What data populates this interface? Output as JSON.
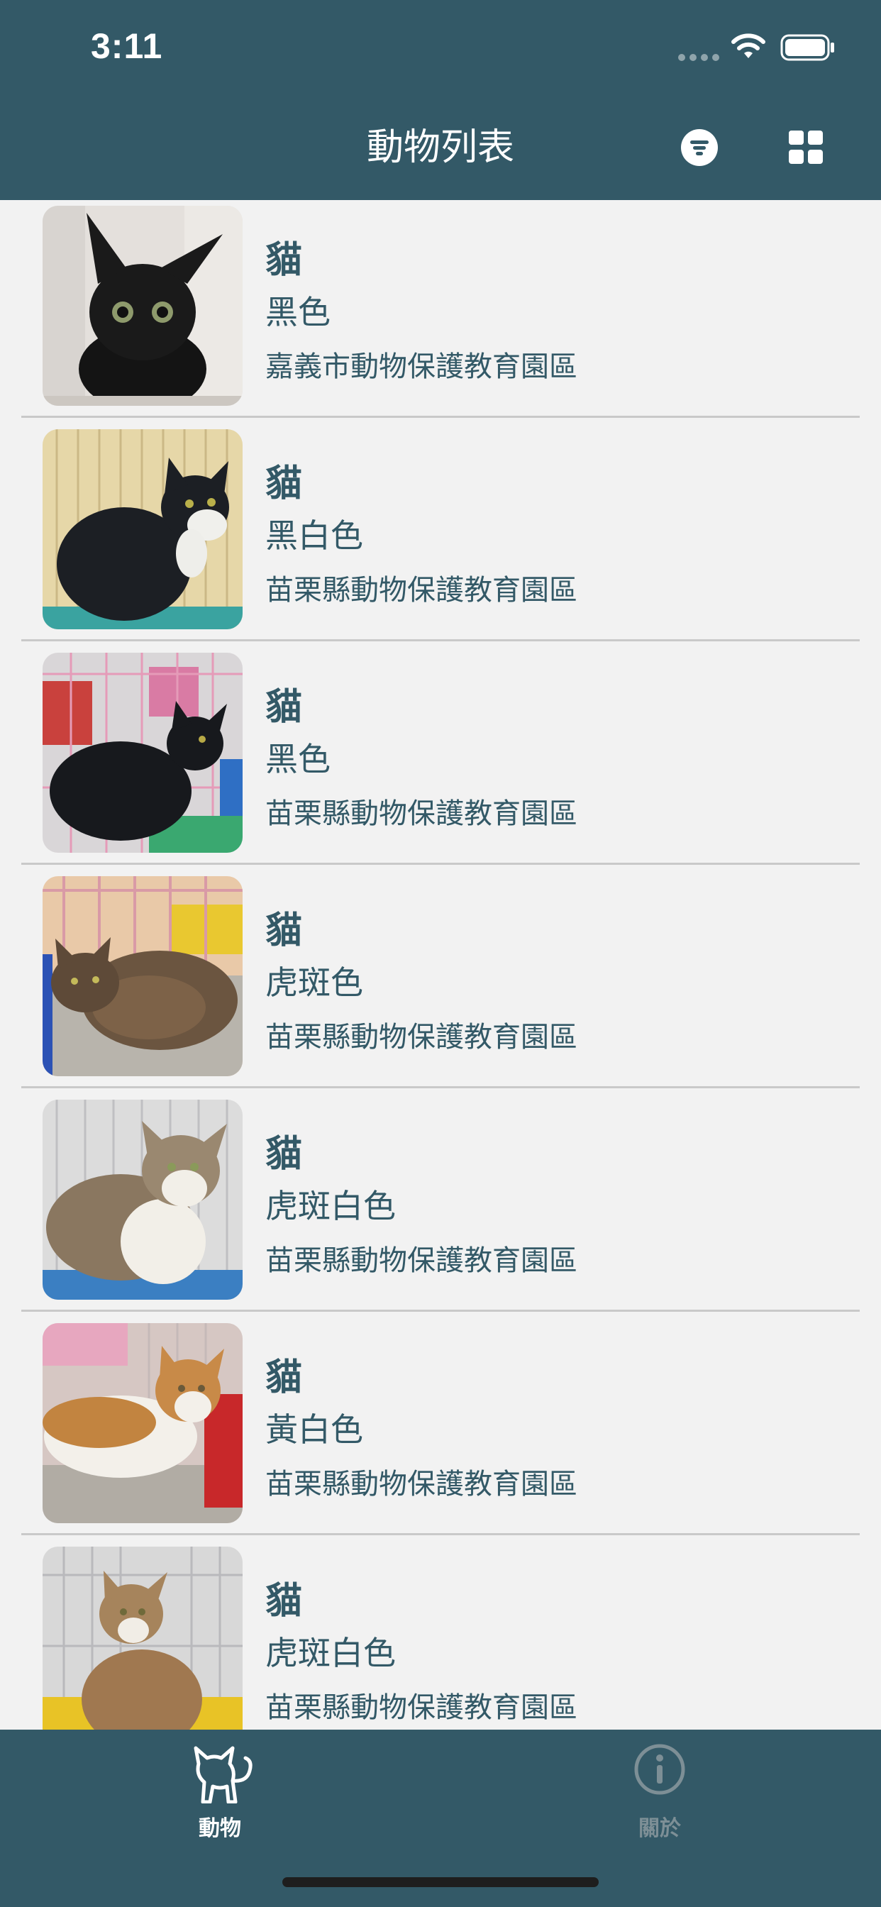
{
  "status_bar": {
    "time": "3:11"
  },
  "nav": {
    "title": "動物列表",
    "filter_icon": "filter-icon",
    "grid_icon": "grid-view-icon"
  },
  "animals": [
    {
      "species": "貓",
      "color": "黑色",
      "shelter": "嘉義市動物保護教育園區",
      "photo": "black-kitten-photo"
    },
    {
      "species": "貓",
      "color": "黑白色",
      "shelter": "苗栗縣動物保護教育園區",
      "photo": "black-white-cat-photo"
    },
    {
      "species": "貓",
      "color": "黑色",
      "shelter": "苗栗縣動物保護教育園區",
      "photo": "black-cat-in-cage-photo"
    },
    {
      "species": "貓",
      "color": "虎斑色",
      "shelter": "苗栗縣動物保護教育園區",
      "photo": "tabby-cat-photo"
    },
    {
      "species": "貓",
      "color": "虎斑白色",
      "shelter": "苗栗縣動物保護教育園區",
      "photo": "tabby-white-cat-photo"
    },
    {
      "species": "貓",
      "color": "黃白色",
      "shelter": "苗栗縣動物保護教育園區",
      "photo": "orange-white-cat-photo"
    },
    {
      "species": "貓",
      "color": "虎斑白色",
      "shelter": "苗栗縣動物保護教育園區",
      "photo": "tabby-white-cat-photo-2"
    }
  ],
  "tabs": [
    {
      "label": "動物",
      "icon": "cat-icon",
      "active": true
    },
    {
      "label": "關於",
      "icon": "info-icon",
      "active": false
    }
  ],
  "colors": {
    "primary": "#335967",
    "background": "#f2f2f2",
    "divider": "#c9c9c9",
    "tab_active": "#ffffff",
    "tab_inactive": "#7d8f96"
  }
}
